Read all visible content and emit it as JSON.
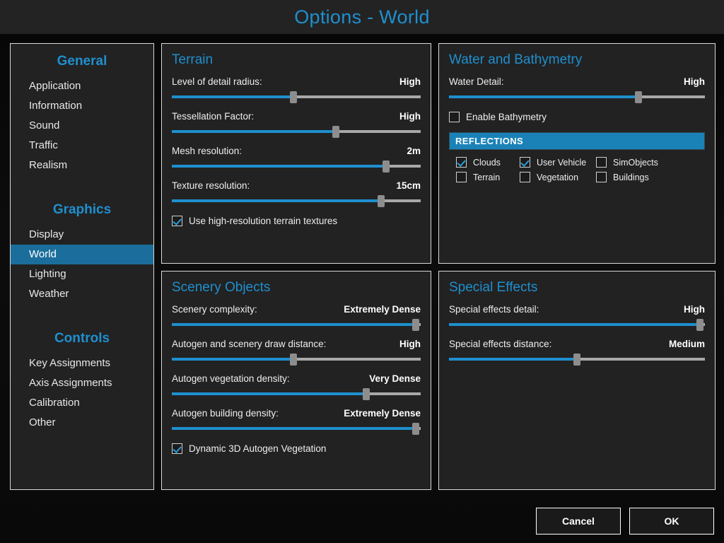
{
  "window": {
    "title": "Options - World"
  },
  "colors": {
    "accent": "#1f8fce",
    "banner": "#1b82b8",
    "highlight": "#1b6e9c",
    "panel_bg": "#222222",
    "app_bg": "#0a0a0a"
  },
  "sidebar": {
    "groups": [
      {
        "title": "General",
        "items": [
          {
            "label": "Application",
            "active": false
          },
          {
            "label": "Information",
            "active": false
          },
          {
            "label": "Sound",
            "active": false
          },
          {
            "label": "Traffic",
            "active": false
          },
          {
            "label": "Realism",
            "active": false
          }
        ]
      },
      {
        "title": "Graphics",
        "items": [
          {
            "label": "Display",
            "active": false
          },
          {
            "label": "World",
            "active": true
          },
          {
            "label": "Lighting",
            "active": false
          },
          {
            "label": "Weather",
            "active": false
          }
        ]
      },
      {
        "title": "Controls",
        "items": [
          {
            "label": "Key Assignments",
            "active": false
          },
          {
            "label": "Axis Assignments",
            "active": false
          },
          {
            "label": "Calibration",
            "active": false
          },
          {
            "label": "Other",
            "active": false
          }
        ]
      }
    ]
  },
  "panels": {
    "terrain": {
      "title": "Terrain",
      "sliders": [
        {
          "label": "Level of detail radius:",
          "value": "High",
          "percent": 49
        },
        {
          "label": "Tessellation Factor:",
          "value": "High",
          "percent": 66
        },
        {
          "label": "Mesh resolution:",
          "value": "2m",
          "percent": 86
        },
        {
          "label": "Texture resolution:",
          "value": "15cm",
          "percent": 84
        }
      ],
      "checkbox": {
        "label": "Use high-resolution terrain textures",
        "checked": true
      }
    },
    "water": {
      "title": "Water and Bathymetry",
      "sliders": [
        {
          "label": "Water Detail:",
          "value": "High",
          "percent": 74
        }
      ],
      "checkbox": {
        "label": "Enable Bathymetry",
        "checked": false
      },
      "banner": "REFLECTIONS",
      "reflections": [
        {
          "label": "Clouds",
          "checked": true
        },
        {
          "label": "User Vehicle",
          "checked": true
        },
        {
          "label": "SimObjects",
          "checked": false
        },
        {
          "label": "Terrain",
          "checked": false
        },
        {
          "label": "Vegetation",
          "checked": false
        },
        {
          "label": "Buildings",
          "checked": false
        }
      ]
    },
    "scenery": {
      "title": "Scenery Objects",
      "sliders": [
        {
          "label": "Scenery complexity:",
          "value": "Extremely Dense",
          "percent": 98
        },
        {
          "label": "Autogen and scenery draw distance:",
          "value": "High",
          "percent": 49
        },
        {
          "label": "Autogen vegetation density:",
          "value": "Very Dense",
          "percent": 78
        },
        {
          "label": "Autogen building density:",
          "value": "Extremely Dense",
          "percent": 98
        }
      ],
      "checkbox": {
        "label": "Dynamic 3D Autogen Vegetation",
        "checked": true
      }
    },
    "effects": {
      "title": "Special Effects",
      "sliders": [
        {
          "label": "Special effects detail:",
          "value": "High",
          "percent": 98
        },
        {
          "label": "Special effects distance:",
          "value": "Medium",
          "percent": 50
        }
      ]
    }
  },
  "footer": {
    "cancel_label": "Cancel",
    "ok_label": "OK"
  }
}
